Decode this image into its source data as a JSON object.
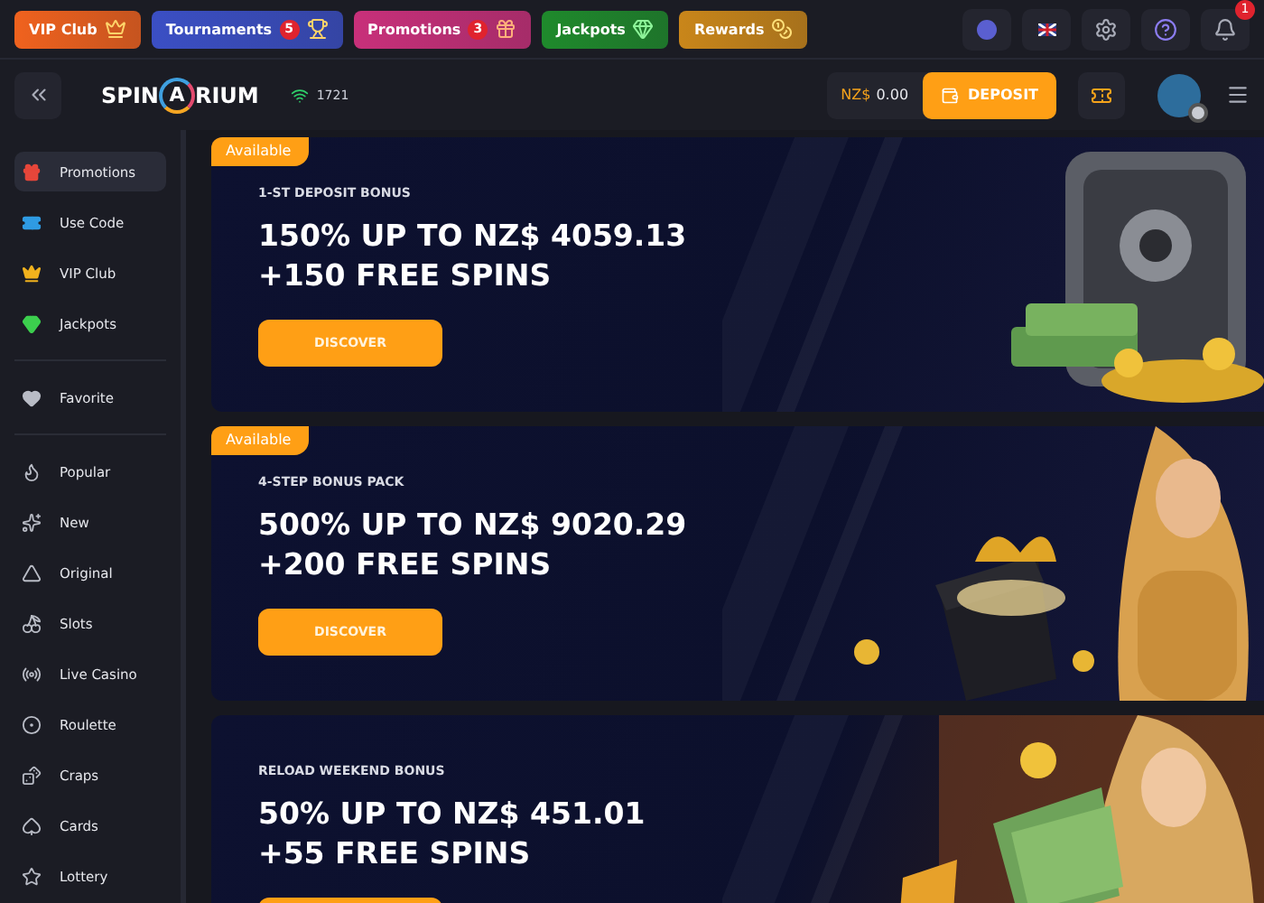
{
  "promo_bar": [
    {
      "label": "VIP Club",
      "color": "#f0621e"
    },
    {
      "label": "Tournaments",
      "color": "#3b4fc4",
      "badge": "5"
    },
    {
      "label": "Promotions",
      "color": "#c8307a",
      "badge": "3"
    },
    {
      "label": "Jackpots",
      "color": "#1f8a2c"
    },
    {
      "label": "Rewards",
      "color": "#c9861a"
    }
  ],
  "notifications": {
    "badge": "1"
  },
  "header": {
    "logo": [
      "SPIN",
      "A",
      "RIUM"
    ],
    "online": "1721",
    "currency": "NZ$",
    "balance": "0.00",
    "deposit": "DEPOSIT"
  },
  "sidebar": [
    [
      {
        "label": "Promotions",
        "selected": true
      },
      {
        "label": "Use Code",
        "selected": false
      },
      {
        "label": "VIP Club",
        "selected": false
      },
      {
        "label": "Jackpots",
        "selected": false
      }
    ],
    [
      {
        "label": "Favorite",
        "selected": false
      }
    ],
    [
      {
        "label": "Popular",
        "selected": false
      },
      {
        "label": "New",
        "selected": false
      },
      {
        "label": "Original",
        "selected": false
      },
      {
        "label": "Slots",
        "selected": false
      },
      {
        "label": "Live Casino",
        "selected": false
      },
      {
        "label": "Roulette",
        "selected": false
      },
      {
        "label": "Craps",
        "selected": false
      },
      {
        "label": "Cards",
        "selected": false
      },
      {
        "label": "Lottery",
        "selected": false
      }
    ]
  ],
  "offers": [
    {
      "badge": "Available",
      "subtitle": "1-ST DEPOSIT BONUS",
      "title": "150% UP TO NZ$ 4059.13",
      "extra": "+150 FREE SPINS",
      "button": "DISCOVER"
    },
    {
      "badge": "Available",
      "subtitle": "4-STEP BONUS PACK",
      "title": "500% UP TO NZ$ 9020.29",
      "extra": "+200 FREE SPINS",
      "button": "DISCOVER"
    },
    {
      "subtitle": "RELOAD WEEKEND BONUS",
      "title": "50% UP TO NZ$ 451.01",
      "extra": "+55 FREE SPINS"
    }
  ]
}
